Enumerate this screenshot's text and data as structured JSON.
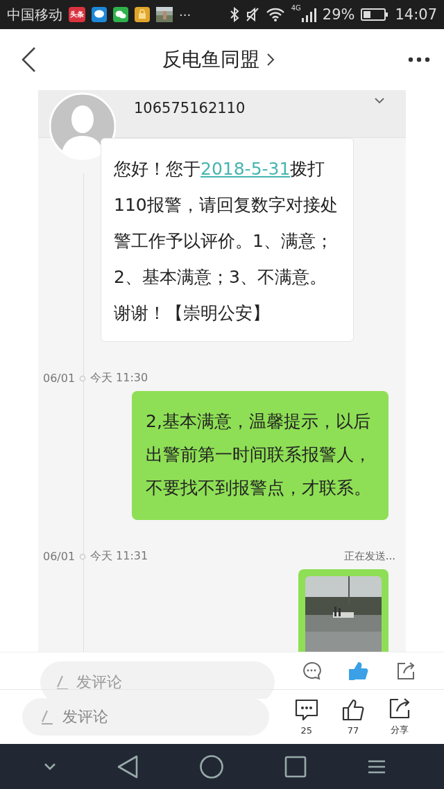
{
  "status_bar": {
    "carrier": "中国移动",
    "app_badge": "头条",
    "more": "···",
    "network": "4G",
    "battery_percent": "29%",
    "time": "14:07"
  },
  "header": {
    "title": "反电鱼同盟"
  },
  "conversation": {
    "sender": "106575162110",
    "received": {
      "text_before": "您好！您于",
      "link": "2018-5-31",
      "text_after": "拨打110报警，请回复数字对接处警工作予以评价。1、满意；2、基本满意；3、不满意。谢谢！【崇明公安】"
    },
    "entries": [
      {
        "kind": "text",
        "date": "06/01",
        "time": "今天 11:30",
        "text": "2,基本满意，温馨提示，以后出警前第一时间联系报警人，不要找不到报警点，才联系。"
      },
      {
        "date": "06/01",
        "time": "今天 11:31",
        "status": "正在发送..."
      }
    ]
  },
  "inner_bar": {
    "placeholder": "发评论",
    "liked": true
  },
  "comment_bar": {
    "placeholder": "发评论",
    "liked": false,
    "actions": [
      {
        "kind": "comment",
        "label": "25"
      },
      {
        "kind": "like",
        "label": "77"
      },
      {
        "kind": "share",
        "label": "分享"
      }
    ]
  }
}
